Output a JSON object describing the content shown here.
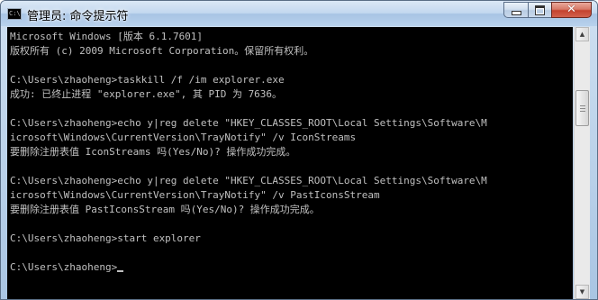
{
  "window": {
    "title": "管理员: 命令提示符",
    "app_icon_text": "C:\\",
    "close_glyph": "✕",
    "colors": {
      "console_bg": "#000000",
      "console_text": "#c0c0c0",
      "close_button": "#c4422e"
    }
  },
  "console": {
    "lines": [
      "Microsoft Windows [版本 6.1.7601]",
      "版权所有 (c) 2009 Microsoft Corporation。保留所有权利。",
      "",
      "C:\\Users\\zhaoheng>taskkill /f /im explorer.exe",
      "成功: 已终止进程 \"explorer.exe\", 其 PID 为 7636。",
      "",
      "C:\\Users\\zhaoheng>echo y|reg delete \"HKEY_CLASSES_ROOT\\Local Settings\\Software\\M",
      "icrosoft\\Windows\\CurrentVersion\\TrayNotify\" /v IconStreams",
      "要删除注册表值 IconStreams 吗(Yes/No)? 操作成功完成。",
      "",
      "C:\\Users\\zhaoheng>echo y|reg delete \"HKEY_CLASSES_ROOT\\Local Settings\\Software\\M",
      "icrosoft\\Windows\\CurrentVersion\\TrayNotify\" /v PastIconsStream",
      "要删除注册表值 PastIconsStream 吗(Yes/No)? 操作成功完成。",
      "",
      "C:\\Users\\zhaoheng>start explorer",
      ""
    ],
    "prompt": "C:\\Users\\zhaoheng>"
  },
  "scrollbar": {
    "up_glyph": "▲",
    "down_glyph": "▼"
  }
}
